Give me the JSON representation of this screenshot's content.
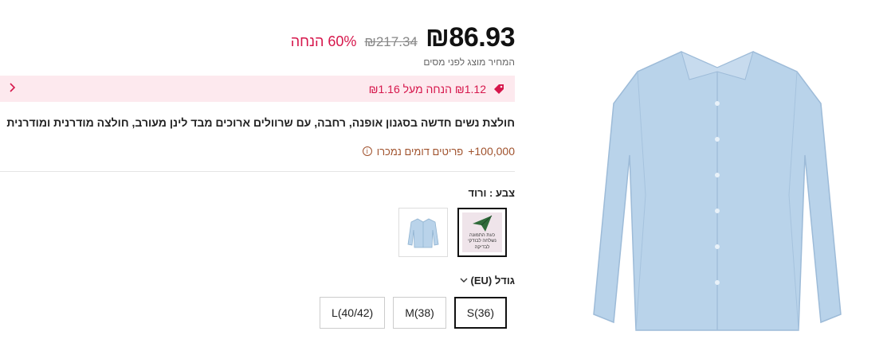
{
  "product": {
    "price_now": "₪86.93",
    "price_was": "₪217.34",
    "discount": "60% הנחה",
    "tax_note": "המחיר מוצג לפני מסים",
    "coupon": {
      "text": "₪1.12 הנחה מעל ₪1.16",
      "icon": "tag-icon",
      "chevron": "chevron-left-icon"
    },
    "title": "חולצת נשים חדשה בסגנון אופנה, רחבה, עם שרוולים ארוכים מבד לינן מעורב, חולצה מודרנית ומודרנית",
    "sold": {
      "count": "+100,000",
      "label": "פריטים דומים נמכרו"
    },
    "color": {
      "label": "צבע : ורוד",
      "swatches": [
        {
          "name": "pink-placeholder",
          "caption": "כעת התמונה נשלחה לבודקי לבדיקה",
          "selected": true
        },
        {
          "name": "light-blue-shirt",
          "selected": false
        }
      ]
    },
    "size": {
      "label": "גודל (EU)",
      "options": [
        {
          "label": "S(36)",
          "selected": true
        },
        {
          "label": "M(38)",
          "selected": false
        },
        {
          "label": "L(40/42)",
          "selected": false
        }
      ]
    }
  },
  "colors": {
    "accent": "#d6164b",
    "coupon_bg": "#fde9ee",
    "sold_text": "#a0522d",
    "shirt": "#b9d3ea"
  }
}
